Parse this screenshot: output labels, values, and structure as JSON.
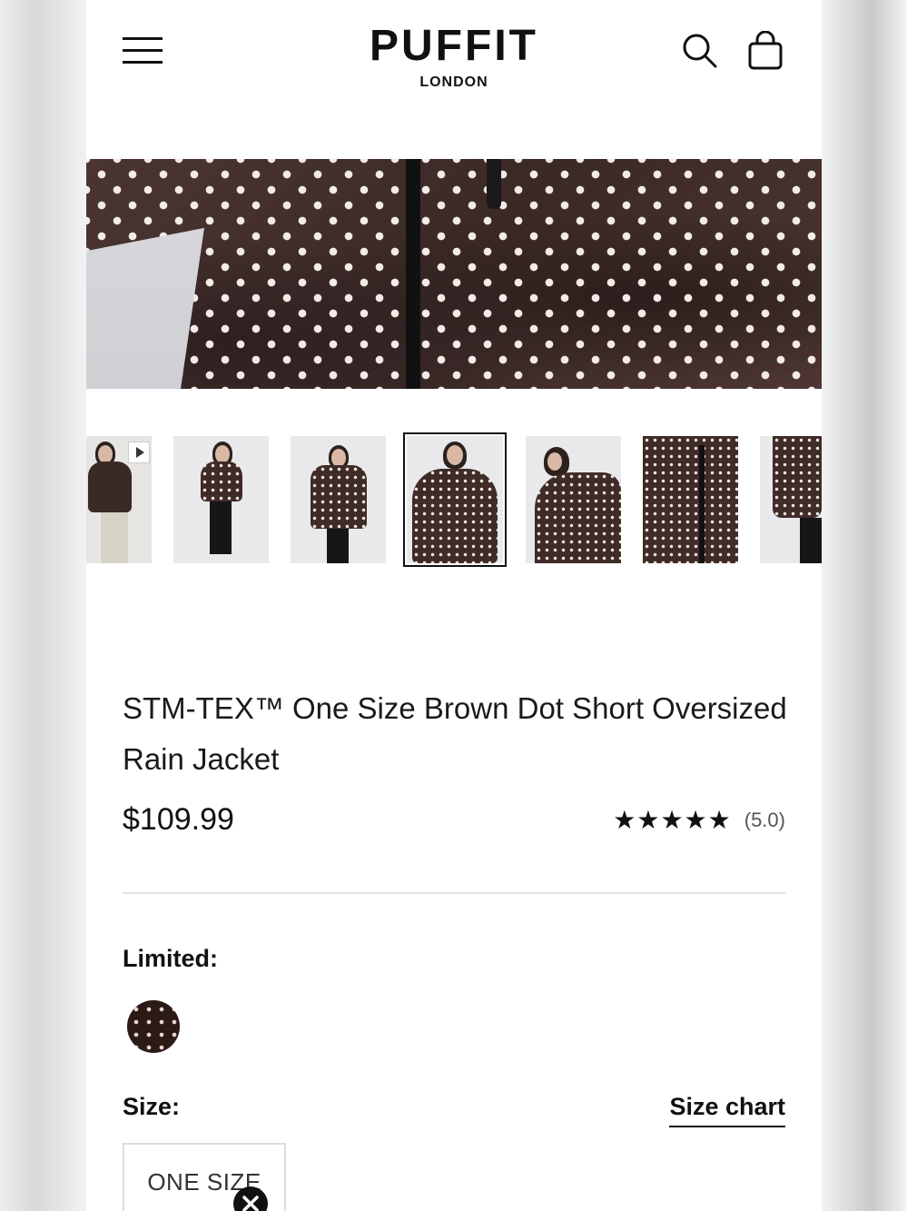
{
  "header": {
    "brand": "PUFFIT",
    "city": "LONDON",
    "menu_icon": "hamburger-icon",
    "search_icon": "search-icon",
    "cart_icon": "shopping-bag-icon"
  },
  "gallery": {
    "thumbnails": [
      {
        "type": "video"
      },
      {
        "type": "image"
      },
      {
        "type": "image"
      },
      {
        "type": "image",
        "active": true
      },
      {
        "type": "image"
      },
      {
        "type": "image"
      },
      {
        "type": "image"
      }
    ]
  },
  "product": {
    "title": "STM-TEX™ One Size Brown Dot Short Oversized Rain Jacket",
    "price": "$109.99",
    "stars": "★★★★★",
    "rating": "(5.0)",
    "color_label": "Limited:",
    "size_label": "Size:",
    "size_chart": "Size chart",
    "size_option": "ONE SIZE"
  },
  "colors": {
    "swatch": "#2c1a17",
    "accent": "#111111"
  }
}
